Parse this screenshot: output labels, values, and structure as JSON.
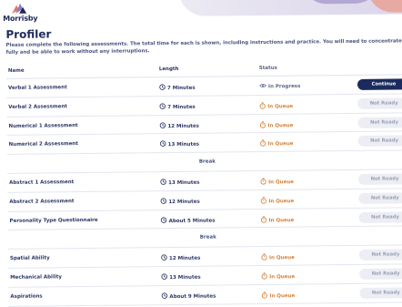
{
  "brand": {
    "name": "Morrisby"
  },
  "page": {
    "title": "Profiler",
    "intro": "Please complete the following assessments. The total time for each is shown, including instructions and practice. You will need to concentrate fully and be able to work without any interruptions."
  },
  "table": {
    "headers": {
      "name": "Name",
      "length": "Length",
      "status": "Status"
    },
    "rows": [
      {
        "name": "Verbal 1 Assessment",
        "length": "7 Minutes",
        "status": "In Progress",
        "action": "Continue"
      },
      {
        "name": "Verbal 2 Assessment",
        "length": "7 Minutes",
        "status": "In Queue",
        "action": "Not Ready"
      },
      {
        "name": "Numerical 1 Assessment",
        "length": "12 Minutes",
        "status": "In Queue",
        "action": "Not Ready"
      },
      {
        "name": "Numerical 2 Assessment",
        "length": "13 Minutes",
        "status": "In Queue",
        "action": "Not Ready"
      },
      {
        "break": "Break"
      },
      {
        "name": "Abstract 1 Assessment",
        "length": "13 Minutes",
        "status": "In Queue",
        "action": "Not Ready"
      },
      {
        "name": "Abstract 2 Assessment",
        "length": "12 Minutes",
        "status": "In Queue",
        "action": "Not Ready"
      },
      {
        "name": "Personality Type Questionnaire",
        "length": "About 5 Minutes",
        "status": "In Queue",
        "action": "Not Ready"
      },
      {
        "break": "Break"
      },
      {
        "name": "Spatial Ability",
        "length": "12 Minutes",
        "status": "In Queue",
        "action": "Not Ready"
      },
      {
        "name": "Mechanical Ability",
        "length": "13 Minutes",
        "status": "In Queue",
        "action": "Not Ready"
      },
      {
        "name": "Aspirations",
        "length": "About 9 Minutes",
        "status": "In Queue",
        "action": "Not Ready"
      }
    ]
  },
  "icons": {
    "length": "clock-icon",
    "in_progress": "eye-icon",
    "in_queue": "stopwatch-icon"
  },
  "colors": {
    "navy": "#1b2b5e",
    "queue": "#d4843c",
    "progress": "#5a6a8a",
    "disabled_bg": "#eceef3"
  }
}
